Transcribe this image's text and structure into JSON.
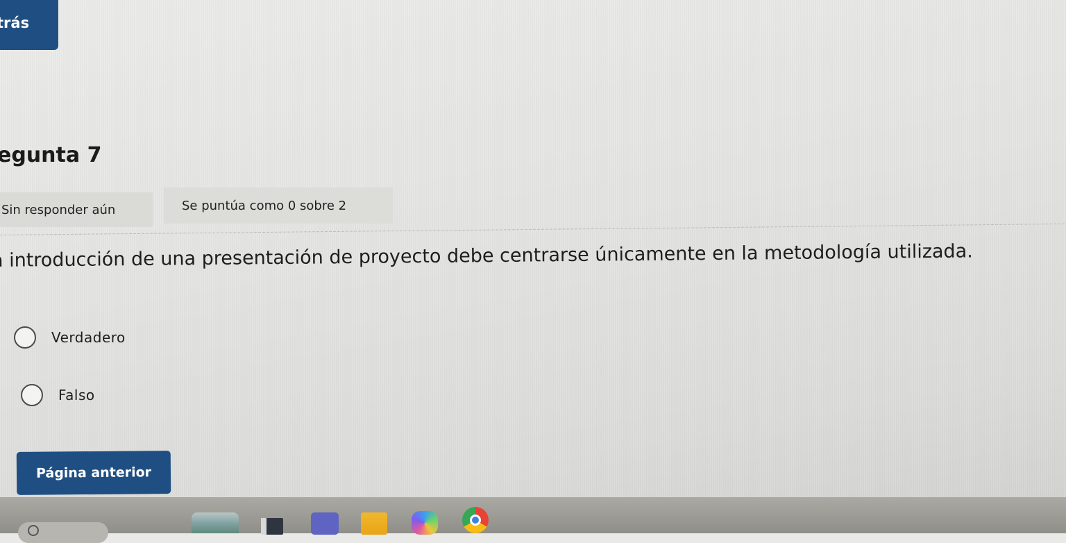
{
  "nav": {
    "back_label": "trás"
  },
  "question": {
    "heading": "egunta 7",
    "status": "Sin responder aún",
    "score": "Se puntúa como 0 sobre 2",
    "text": "a introducción de una presentación de proyecto debe centrarse únicamente en la metodología utilizada.",
    "options": [
      {
        "label": "Verdadero",
        "selected": false
      },
      {
        "label": "Falso",
        "selected": false
      }
    ]
  },
  "footer": {
    "prev_label": "Página anterior"
  },
  "taskbar": {
    "icons": [
      "search-icon",
      "widgets-icon",
      "file-explorer-icon",
      "teams-icon",
      "folder-icon",
      "copilot-icon",
      "chrome-icon"
    ]
  },
  "colors": {
    "button_blue": "#1f4f82",
    "page_bg": "#e6e6e4"
  }
}
